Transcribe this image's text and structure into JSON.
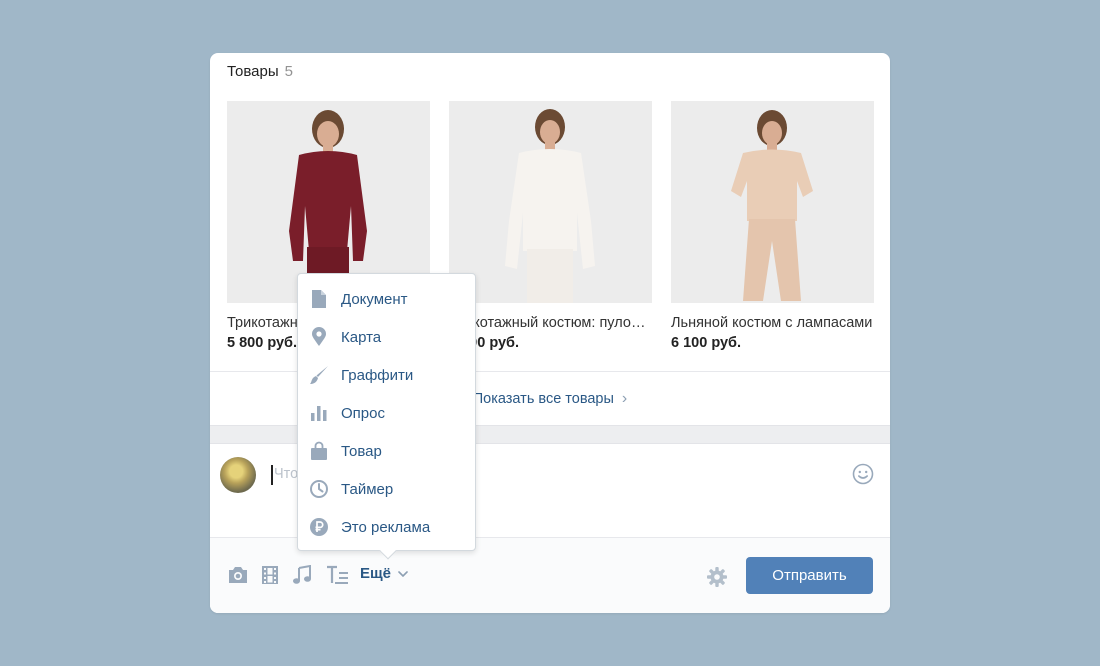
{
  "header": {
    "title": "Товары",
    "count": "5"
  },
  "products": [
    {
      "name": "Трикотажный костюм: свитшот и брюки",
      "price": "5 800 руб.",
      "color": "#7a1e2a"
    },
    {
      "name": "Трикотажный костюм: пуловер",
      "price": "5 800 руб.",
      "color": "#f6f3ef"
    },
    {
      "name": "Льняной костюм с лампасами",
      "price": "6 100 руб.",
      "color": "#e9cdb6"
    }
  ],
  "show_all": {
    "label": "Показать все товары"
  },
  "composer": {
    "placeholder": "Что у Вас нового?"
  },
  "toolbar": {
    "more_label": "Ещё",
    "send_label": "Отправить"
  },
  "menu": {
    "items": [
      {
        "label": "Документ",
        "icon": "document-icon"
      },
      {
        "label": "Карта",
        "icon": "map-pin-icon"
      },
      {
        "label": "Граффити",
        "icon": "brush-icon"
      },
      {
        "label": "Опрос",
        "icon": "poll-icon"
      },
      {
        "label": "Товар",
        "icon": "shopping-bag-icon"
      },
      {
        "label": "Таймер",
        "icon": "clock-icon"
      },
      {
        "label": "Это реклама",
        "icon": "ruble-icon"
      }
    ]
  },
  "colors": {
    "background": "#a0b7c8",
    "accent": "#5181b8",
    "link": "#2a5885",
    "icon": "#99a9bb"
  }
}
